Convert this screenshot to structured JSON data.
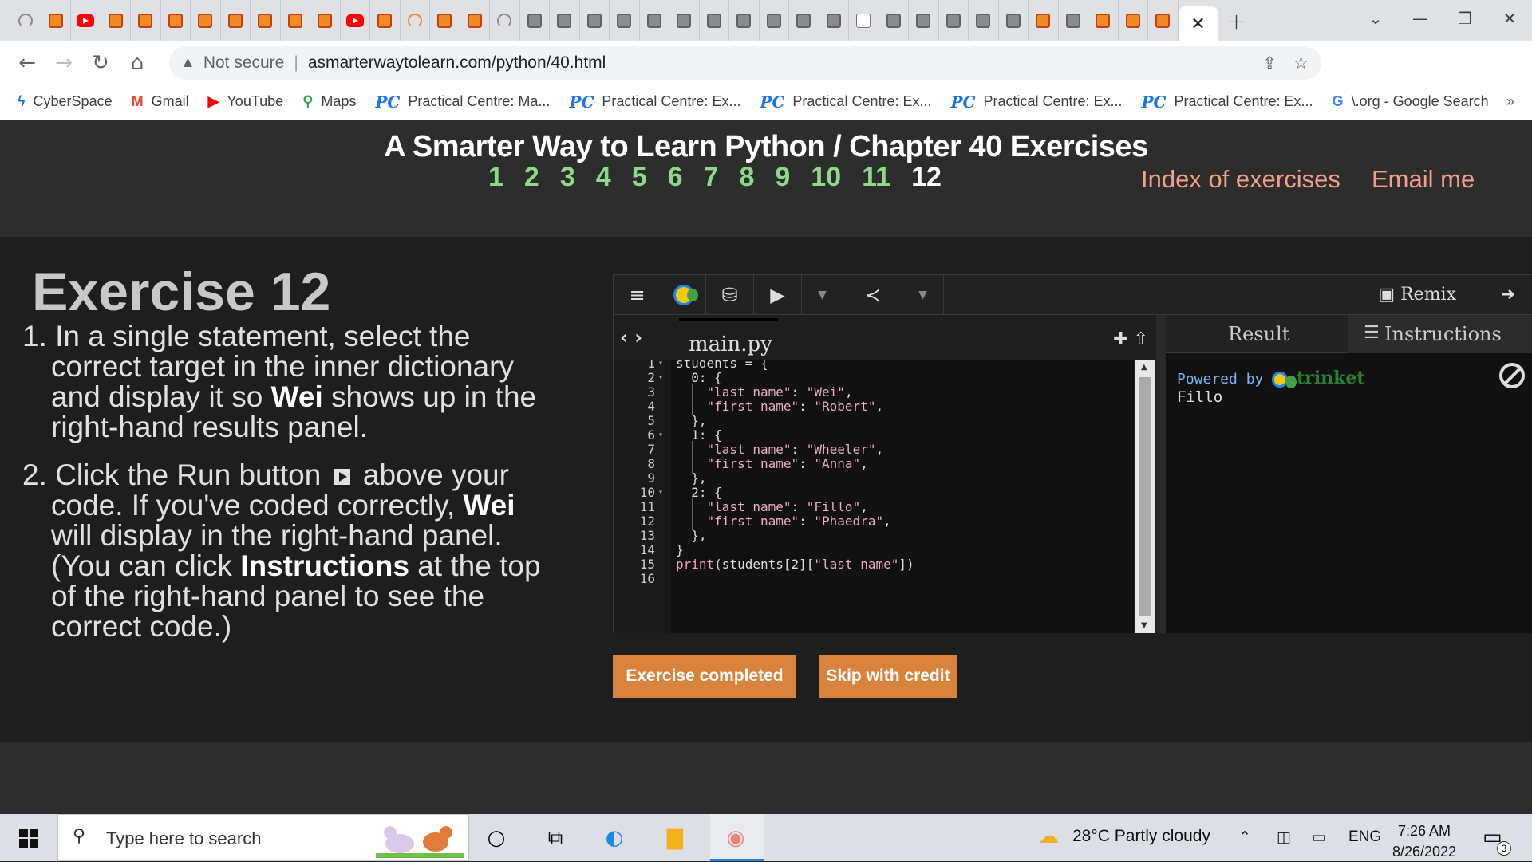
{
  "browser": {
    "address": {
      "warning": "Not secure",
      "url": "asmarterwaytolearn.com/python/40.html"
    },
    "bookmarks": [
      {
        "icon": "cyberspace-icon",
        "label": "CyberSpace"
      },
      {
        "icon": "gmail-icon",
        "label": "Gmail"
      },
      {
        "icon": "youtube-icon",
        "label": "YouTube"
      },
      {
        "icon": "maps-icon",
        "label": "Maps"
      },
      {
        "icon": "pc-icon",
        "label": "Practical Centre: Ma..."
      },
      {
        "icon": "pc-icon",
        "label": "Practical Centre: Ex..."
      },
      {
        "icon": "pc-icon",
        "label": "Practical Centre: Ex..."
      },
      {
        "icon": "pc-icon",
        "label": "Practical Centre: Ex..."
      },
      {
        "icon": "pc-icon",
        "label": "Practical Centre: Ex..."
      },
      {
        "icon": "google-icon",
        "label": "\\.org - Google Search"
      }
    ]
  },
  "page": {
    "title": "A Smarter Way to Learn Python / Chapter 40 Exercises",
    "exercise_numbers": [
      "1",
      "2",
      "3",
      "4",
      "5",
      "6",
      "7",
      "8",
      "9",
      "10",
      "11",
      "12"
    ],
    "current_exercise": "12",
    "index_link": "Index of exercises",
    "email_link": "Email me",
    "exercise_title": "Exercise 12",
    "instructions": {
      "item1": {
        "num": "1.",
        "pre": "In a single statement, select the correct target in the inner dictionary and display it so",
        "bold": "Wei",
        "post": "shows up in the right-hand results panel."
      },
      "item2": {
        "num": "2.",
        "pre": "Click the Run button",
        "mid1": "above your code. If you've coded correctly,",
        "bold1": "Wei",
        "mid2": "will display in the right-hand panel. (You can click",
        "bold2": "Instructions",
        "post": "at the top of the right-hand panel to see the correct code.)"
      }
    },
    "buttons": {
      "completed": "Exercise completed",
      "skip": "Skip with credit"
    }
  },
  "trinket": {
    "remix_label": "Remix",
    "file_tab": "main.py",
    "code_lines": [
      {
        "n": "1",
        "fold": true,
        "t": "students = {"
      },
      {
        "n": "2",
        "fold": true,
        "t": "  0: {"
      },
      {
        "n": "3",
        "fold": false,
        "t": "    \"last name\": \"Wei\","
      },
      {
        "n": "4",
        "fold": false,
        "t": "    \"first name\": \"Robert\","
      },
      {
        "n": "5",
        "fold": false,
        "t": "  },"
      },
      {
        "n": "6",
        "fold": true,
        "t": "  1: {"
      },
      {
        "n": "7",
        "fold": false,
        "t": "    \"last name\": \"Wheeler\","
      },
      {
        "n": "8",
        "fold": false,
        "t": "    \"first name\": \"Anna\","
      },
      {
        "n": "9",
        "fold": false,
        "t": "  },"
      },
      {
        "n": "10",
        "fold": true,
        "t": "  2: {"
      },
      {
        "n": "11",
        "fold": false,
        "t": "    \"last name\": \"Fillo\","
      },
      {
        "n": "12",
        "fold": false,
        "t": "    \"first name\": \"Phaedra\","
      },
      {
        "n": "13",
        "fold": false,
        "t": "  },"
      },
      {
        "n": "14",
        "fold": false,
        "t": "}"
      },
      {
        "n": "15",
        "fold": false,
        "t": "print(students[2][\"last name\"])"
      },
      {
        "n": "16",
        "fold": false,
        "t": ""
      }
    ],
    "result_tab": "Result",
    "instructions_tab": "Instructions",
    "powered_by": "Powered by",
    "trinket_brand": "trinket",
    "output": "Fillo"
  },
  "taskbar": {
    "search_placeholder": "Type here to search",
    "weather": "28°C  Partly cloudy",
    "language": "ENG",
    "time": "7:26 AM",
    "date": "8/26/2022",
    "notification_count": "3"
  }
}
